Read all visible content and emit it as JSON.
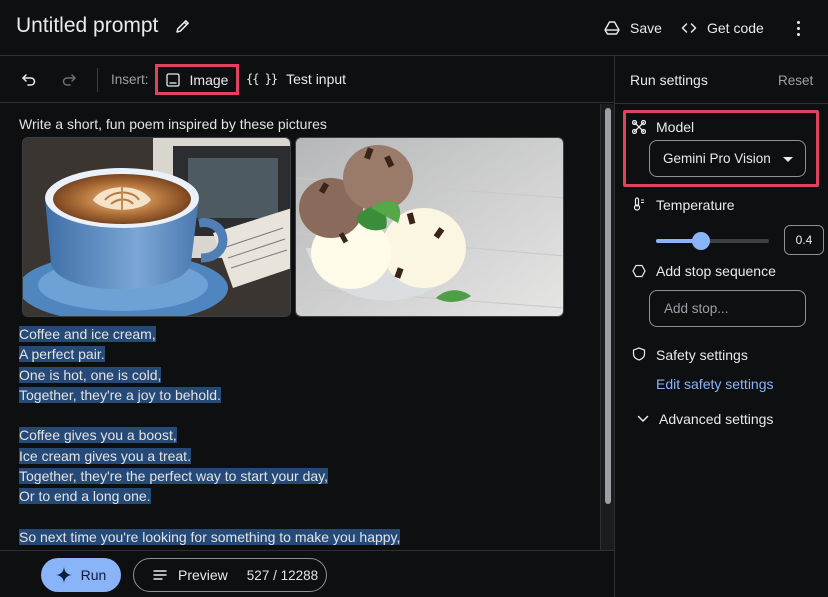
{
  "header": {
    "title": "Untitled prompt",
    "save_label": "Save",
    "code_label": "Get code"
  },
  "toolbar": {
    "insert_label": "Insert:",
    "image_label": "Image",
    "test_input_braces": "{{ }}",
    "test_input_label": "Test input"
  },
  "prompt": {
    "text": "Write a short, fun poem inspired by these pictures",
    "images": [
      "coffee-latte-art-photo",
      "ice-cream-scoops-photo"
    ]
  },
  "output": {
    "lines": [
      " Coffee and ice cream,",
      "A perfect pair.",
      "One is hot, one is cold,",
      "Together, they're a joy to behold.",
      "",
      "Coffee gives you a boost,",
      "Ice cream gives you a treat.",
      "Together, they're the perfect way to start your day,",
      "Or to end a long one.",
      "",
      "So next time you're looking for something to make you happy,"
    ]
  },
  "footer": {
    "run_label": "Run",
    "preview_label": "Preview",
    "token_count": "527 / 12288"
  },
  "run_settings": {
    "title": "Run settings",
    "reset_label": "Reset",
    "model_label": "Model",
    "model_value": "Gemini Pro Vision",
    "temperature_label": "Temperature",
    "temperature_value": "0.4",
    "temperature_fraction": 0.4,
    "stop_label": "Add stop sequence",
    "stop_placeholder": "Add stop...",
    "safety_label": "Safety settings",
    "safety_link": "Edit safety settings",
    "advanced_label": "Advanced settings"
  },
  "colors": {
    "highlight": "#e0435f",
    "accent": "#8ab4f8",
    "selection": "#264a78"
  }
}
